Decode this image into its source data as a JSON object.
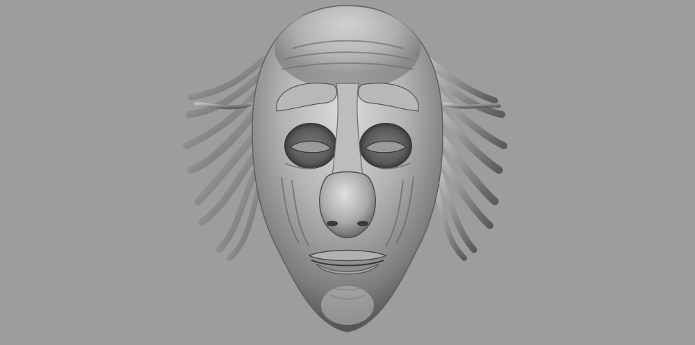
{
  "scene": {
    "subject": "sculpted-old-man-head",
    "background_color": "#9d9d9d",
    "material_color": "#8a8a8a",
    "highlight_color": "#e6e6e6",
    "shadow_color": "#2f2f2f"
  }
}
